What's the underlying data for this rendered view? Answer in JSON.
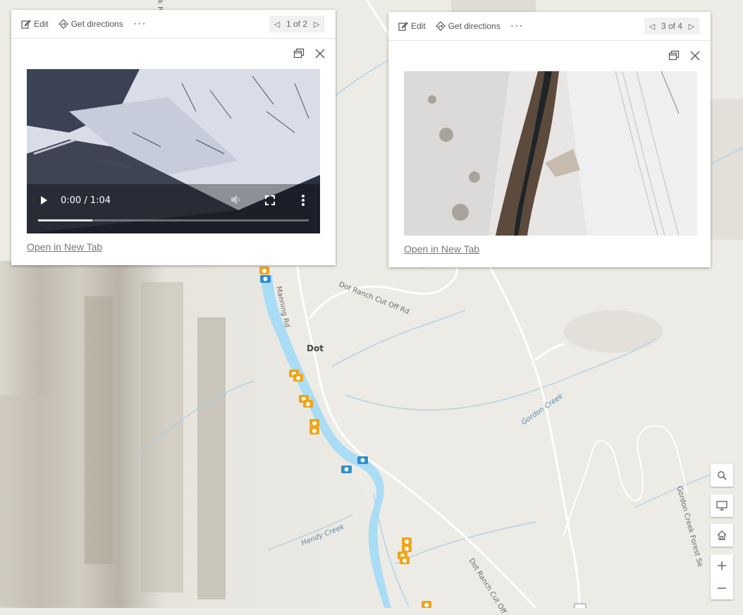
{
  "map": {
    "place_label": "Dot",
    "road_labels": {
      "manning_rd": "Manning Rd",
      "dot_ranch_cut_off_rd": "Dot Ranch Cut Off Rd",
      "dot_ranch_cut_off_lower": "Dot Ranch Cut Off",
      "gordon_creek_forest": "Gordon Creek Forest Se",
      "top_road_fragment": "k R"
    },
    "water_labels": {
      "gordon_creek": "Gordon Creek",
      "hendy_creek": "Hendy Creek"
    },
    "marker_colors": {
      "photo_cluster": "#f0a416",
      "camera": "#2d8fce"
    }
  },
  "popups": [
    {
      "edit_label": "Edit",
      "directions_label": "Get directions",
      "more_label": "···",
      "pager": "1 of 2",
      "media_type": "video",
      "video": {
        "time": "0:00 / 1:04",
        "progress": 0.2
      },
      "link_label": "Open in New Tab"
    },
    {
      "edit_label": "Edit",
      "directions_label": "Get directions",
      "more_label": "···",
      "pager": "3 of 4",
      "media_type": "image",
      "link_label": "Open in New Tab"
    }
  ],
  "map_controls": [
    "search-icon",
    "screen-icon",
    "home-icon",
    "zoom-in-icon",
    "zoom-out-icon"
  ],
  "colors": {
    "river": "#a9dcf5",
    "road": "#ffffff",
    "stream": "#a9cde3",
    "link": "#777777"
  }
}
